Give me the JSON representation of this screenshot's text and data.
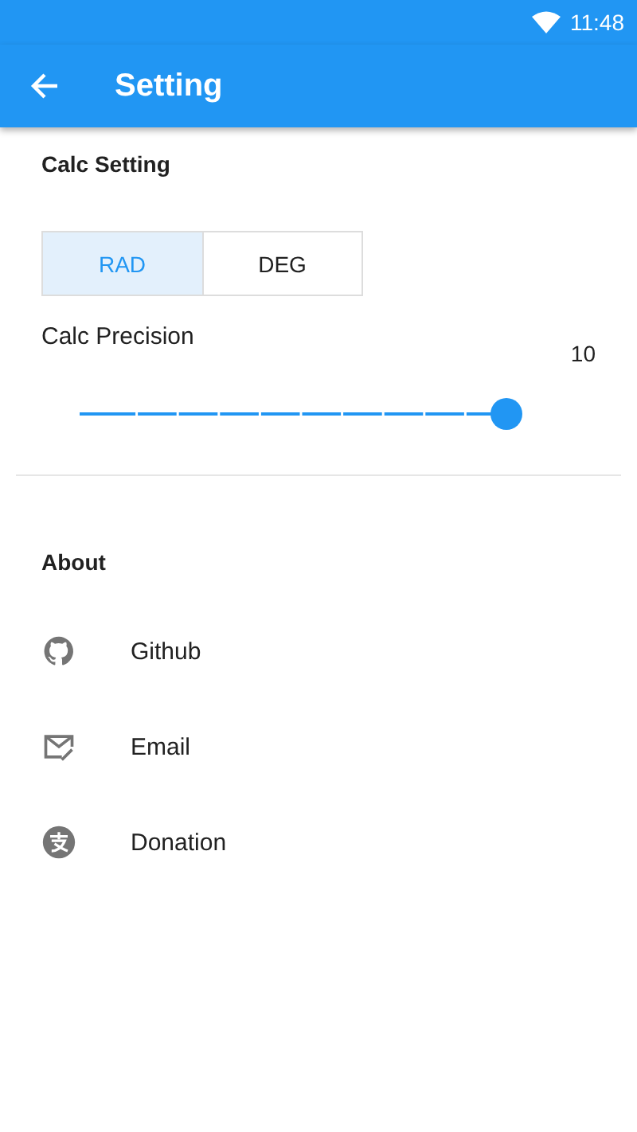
{
  "status_bar": {
    "time": "11:48"
  },
  "app_bar": {
    "title": "Setting"
  },
  "calc_setting": {
    "title": "Calc Setting",
    "angle_modes": [
      {
        "label": "RAD",
        "selected": true
      },
      {
        "label": "DEG",
        "selected": false
      }
    ],
    "precision": {
      "label": "Calc Precision",
      "reading": "10",
      "level": 1
    }
  },
  "about": {
    "title": "About",
    "items": [
      {
        "kind": "github",
        "label": "Github"
      },
      {
        "kind": "email",
        "label": "Email"
      },
      {
        "kind": "donation",
        "label": "Donation"
      }
    ]
  }
}
